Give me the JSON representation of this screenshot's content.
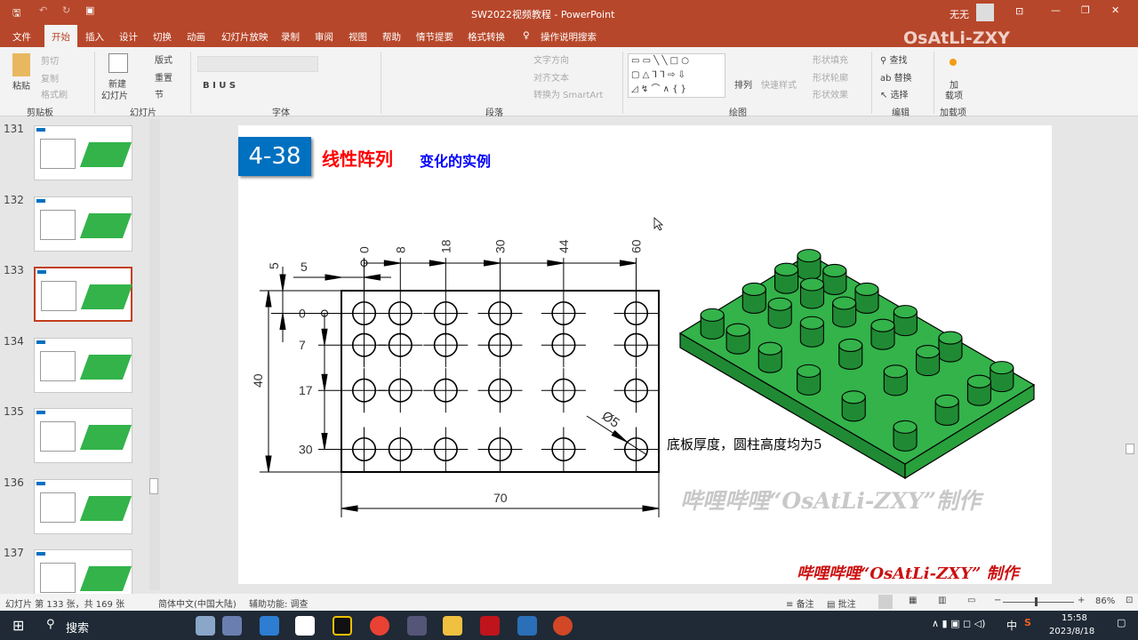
{
  "window": {
    "title": "SW2022视频教程  -  PowerPoint",
    "user": "无无",
    "watermark": "OsAtLi-ZXY"
  },
  "tabs": [
    "文件",
    "开始",
    "插入",
    "设计",
    "切换",
    "动画",
    "幻灯片放映",
    "录制",
    "审阅",
    "视图",
    "帮助",
    "情节提要",
    "格式转换",
    "操作说明搜索"
  ],
  "ribbon": {
    "clipboard": {
      "paste": "粘贴",
      "cut": "剪切",
      "copy": "复制",
      "format_painter": "格式刷",
      "label": "剪贴板"
    },
    "slides": {
      "new": "新建",
      "new2": "幻灯片",
      "layout": "版式",
      "reset": "重置",
      "section": "节",
      "label": "幻灯片"
    },
    "font": {
      "label": "字体"
    },
    "paragraph": {
      "text_dir": "文字方向",
      "align_text": "对齐文本",
      "smartart": "转换为 SmartArt",
      "label": "段落"
    },
    "drawing": {
      "arrange": "排列",
      "quick_styles": "快速样式",
      "fill": "形状填充",
      "outline": "形状轮廓",
      "effects": "形状效果",
      "label": "绘图"
    },
    "editing": {
      "find": "查找",
      "replace": "替换",
      "select": "选择",
      "label": "编辑"
    },
    "addins": {
      "btn1": "加",
      "btn2": "载项",
      "label": "加载项"
    }
  },
  "thumbnails": [
    "131",
    "132",
    "133",
    "134",
    "135",
    "136",
    "137"
  ],
  "selected_thumbnail": "133",
  "slide": {
    "badge": "4-38",
    "title": "线性阵列",
    "subtitle": "变化的实例",
    "dims_x": [
      "0",
      "8",
      "18",
      "30",
      "44",
      "60"
    ],
    "dims_y": [
      "0",
      "7",
      "17",
      "30"
    ],
    "dim_5a": "5",
    "dim_5b": "5",
    "dim_40": "40",
    "dim_70": "70",
    "dim_dia": "Ø5",
    "note": "底板厚度，圆柱高度均为5",
    "watermark": "哔哩哔哩“OsAtLi-ZXY”制作",
    "footer": "哔哩哔哩“OsAtLi-ZXY” 制作",
    "colors": {
      "badge": "#0070c0",
      "title": "#ff0000",
      "subtitle": "#0000ff",
      "model": "#33b34a"
    }
  },
  "status": {
    "slide_info": "幻灯片 第 133 张，共 169 张",
    "language": "简体中文(中国大陆)",
    "accessibility": "辅助功能: 调查",
    "notes": "备注",
    "comments": "批注",
    "zoom": "86%"
  },
  "taskbar": {
    "search": "搜索",
    "time": "15:58",
    "date": "2023/8/18",
    "ime": "中"
  }
}
